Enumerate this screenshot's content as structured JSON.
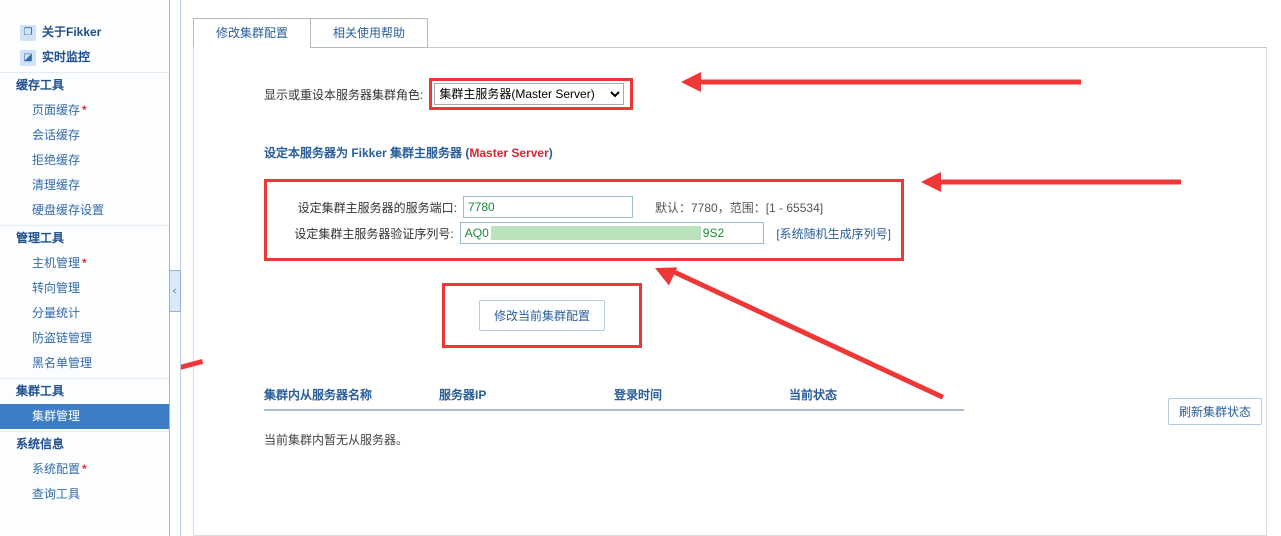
{
  "sidebar": {
    "top": [
      {
        "icon": "❐",
        "label": "关于Fikker"
      },
      {
        "icon": "◪",
        "label": "实时监控"
      }
    ],
    "sections": [
      {
        "title": "缓存工具",
        "items": [
          {
            "label": "页面缓存",
            "star": true
          },
          {
            "label": "会话缓存"
          },
          {
            "label": "拒绝缓存"
          },
          {
            "label": "清理缓存"
          },
          {
            "label": "硬盘缓存设置"
          }
        ]
      },
      {
        "title": "管理工具",
        "items": [
          {
            "label": "主机管理",
            "star": true
          },
          {
            "label": "转向管理"
          },
          {
            "label": "分量统计"
          },
          {
            "label": "防盗链管理"
          },
          {
            "label": "黑名单管理"
          }
        ]
      },
      {
        "title": "集群工具",
        "items": [
          {
            "label": "集群管理",
            "selected": true
          }
        ]
      },
      {
        "title": "系统信息",
        "items": [
          {
            "label": "系统配置",
            "star": true
          },
          {
            "label": "查询工具"
          }
        ]
      }
    ]
  },
  "tabs": {
    "active": "修改集群配置",
    "other": "相关使用帮助"
  },
  "form": {
    "role_label": "显示或重设本服务器集群角色:",
    "role_value": "集群主服务器(Master Server)",
    "subtitle_prefix": "设定本服务器为 Fikker 集群主服务器  (",
    "subtitle_red": "Master Server",
    "subtitle_suffix": ")",
    "port_label": "设定集群主服务器的服务端口:",
    "port_value": "7780",
    "port_hint": "默认：7780，范围：[1 - 65534]",
    "serial_label": "设定集群主服务器验证序列号:",
    "serial_prefix": "AQ0",
    "serial_suffix": "9S2",
    "serial_gen": "[系统随机生成序列号]",
    "submit": "修改当前集群配置"
  },
  "table": {
    "cols": [
      "集群内从服务器名称",
      "服务器IP",
      "登录时间",
      "当前状态"
    ],
    "empty": "当前集群内暂无从服务器。"
  },
  "refresh": "刷新集群状态"
}
